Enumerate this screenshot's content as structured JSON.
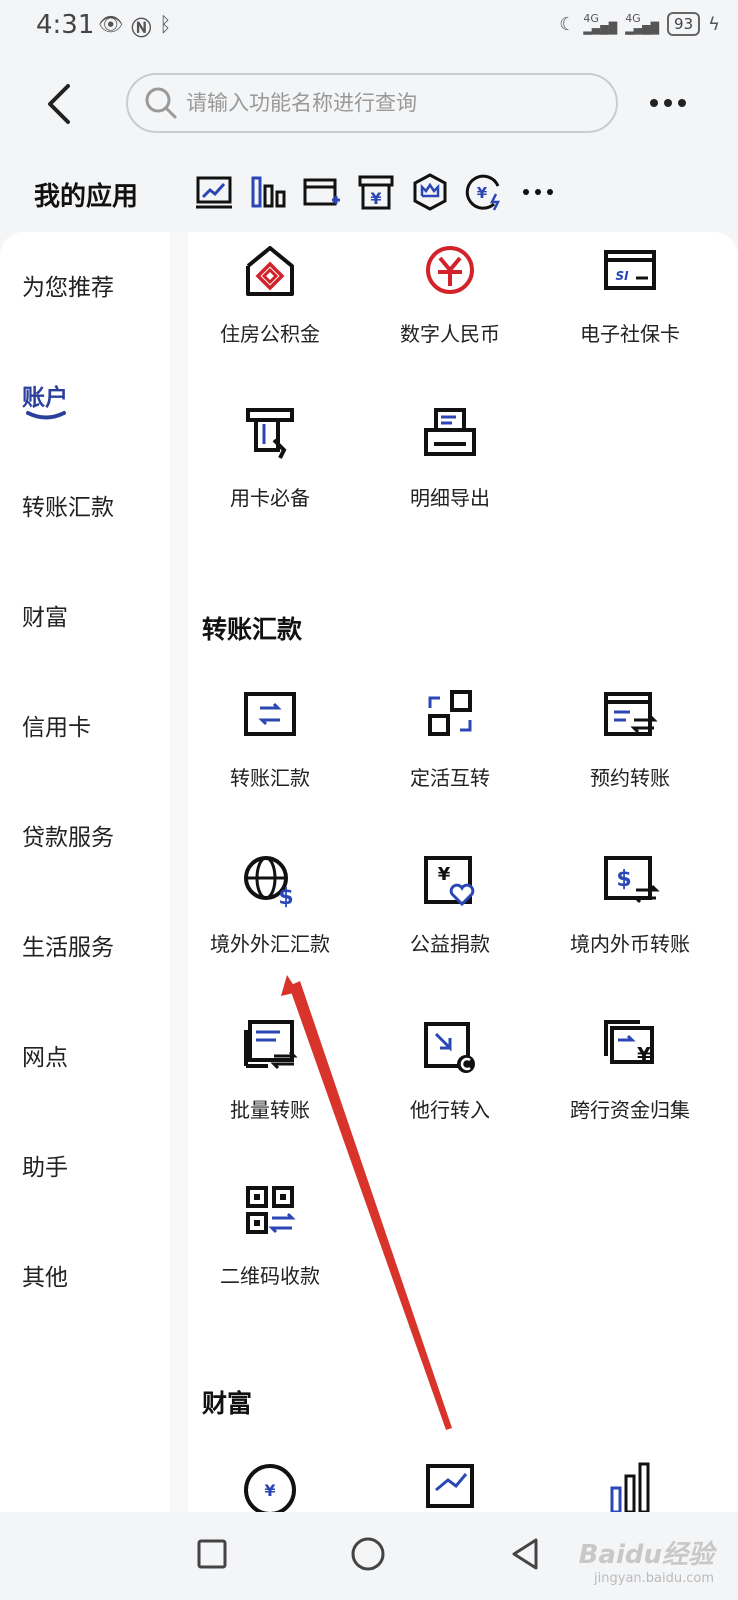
{
  "status_bar": {
    "time": "4:31",
    "battery": "93",
    "signal1": "4G",
    "signal2": "4G"
  },
  "header": {
    "search_placeholder": "请输入功能名称进行查询"
  },
  "my_apps": {
    "title": "我的应用",
    "icons": [
      "chart-trend-icon",
      "bar-chart-icon",
      "card-add-icon",
      "yuan-box-icon",
      "crown-shield-icon",
      "yuan-exchange-icon",
      "more-dots-icon"
    ]
  },
  "sidebar": {
    "items": [
      {
        "label": "为您推荐"
      },
      {
        "label": "账户"
      },
      {
        "label": "转账汇款"
      },
      {
        "label": "财富"
      },
      {
        "label": "信用卡"
      },
      {
        "label": "贷款服务"
      },
      {
        "label": "生活服务"
      },
      {
        "label": "网点"
      },
      {
        "label": "助手"
      },
      {
        "label": "其他"
      }
    ]
  },
  "account_grid": [
    {
      "label": "住房公积金",
      "icon": "house-fund-icon"
    },
    {
      "label": "数字人民币",
      "icon": "digital-rmb-icon"
    },
    {
      "label": "电子社保卡",
      "icon": "social-security-card-icon"
    },
    {
      "label": "用卡必备",
      "icon": "atm-card-icon"
    },
    {
      "label": "明细导出",
      "icon": "printer-icon"
    }
  ],
  "transfer_section": {
    "title": "转账汇款",
    "items": [
      {
        "label": "转账汇款",
        "icon": "transfer-icon"
      },
      {
        "label": "定活互转",
        "icon": "fixed-demand-swap-icon"
      },
      {
        "label": "预约转账",
        "icon": "scheduled-transfer-icon"
      },
      {
        "label": "境外外汇汇款",
        "icon": "globe-dollar-icon"
      },
      {
        "label": "公益捐款",
        "icon": "charity-donation-icon"
      },
      {
        "label": "境内外币转账",
        "icon": "foreign-currency-transfer-icon"
      },
      {
        "label": "批量转账",
        "icon": "batch-transfer-icon"
      },
      {
        "label": "他行转入",
        "icon": "other-bank-in-icon"
      },
      {
        "label": "跨行资金归集",
        "icon": "cross-bank-collect-icon"
      },
      {
        "label": "二维码收款",
        "icon": "qr-collect-icon"
      }
    ]
  },
  "wealth_section": {
    "title": "财富"
  },
  "watermark": {
    "brand": "Baidu经验",
    "url": "jingyan.baidu.com"
  }
}
